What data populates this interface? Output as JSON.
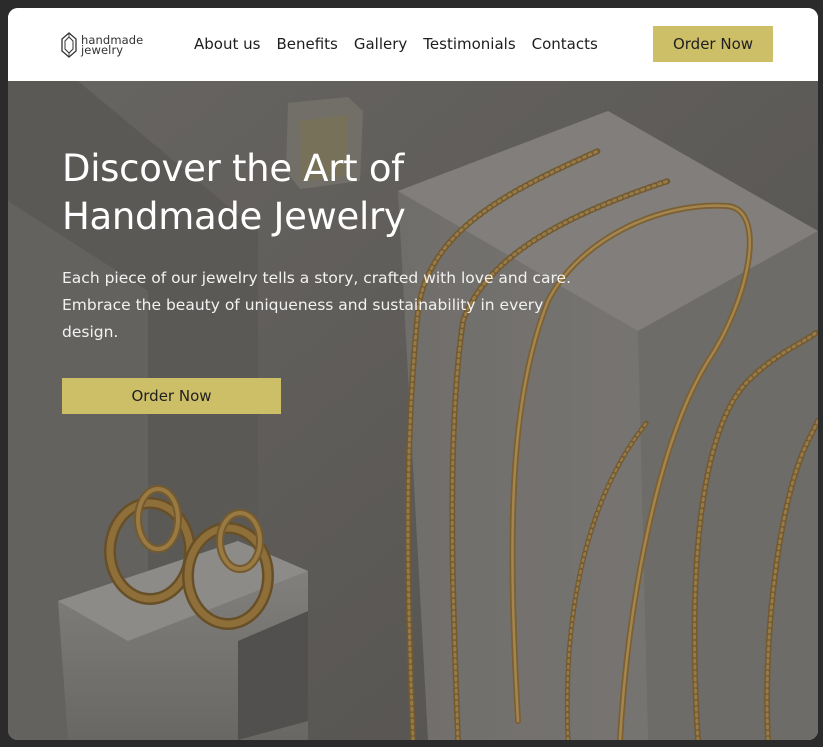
{
  "brand": {
    "line1": "handmade",
    "line2": "jewelry"
  },
  "nav": {
    "items": [
      {
        "label": "About us"
      },
      {
        "label": "Benefits"
      },
      {
        "label": "Gallery"
      },
      {
        "label": "Testimonials"
      },
      {
        "label": "Contacts"
      }
    ],
    "cta_label": "Order Now"
  },
  "hero": {
    "title_line1": "Discover the Art of",
    "title_line2": "Handmade Jewelry",
    "description": "Each piece of our jewelry tells a story, crafted with love and care. Embrace the beauty of uniqueness and sustainability in every design.",
    "cta_label": "Order Now"
  },
  "colors": {
    "accent": "#cdbf68",
    "nav_background": "#ffffff",
    "hero_overlay": "#6e6c69",
    "hero_text": "#ffffff",
    "gold": "#b8924a"
  },
  "icons": {
    "logo": "gem-icon"
  }
}
